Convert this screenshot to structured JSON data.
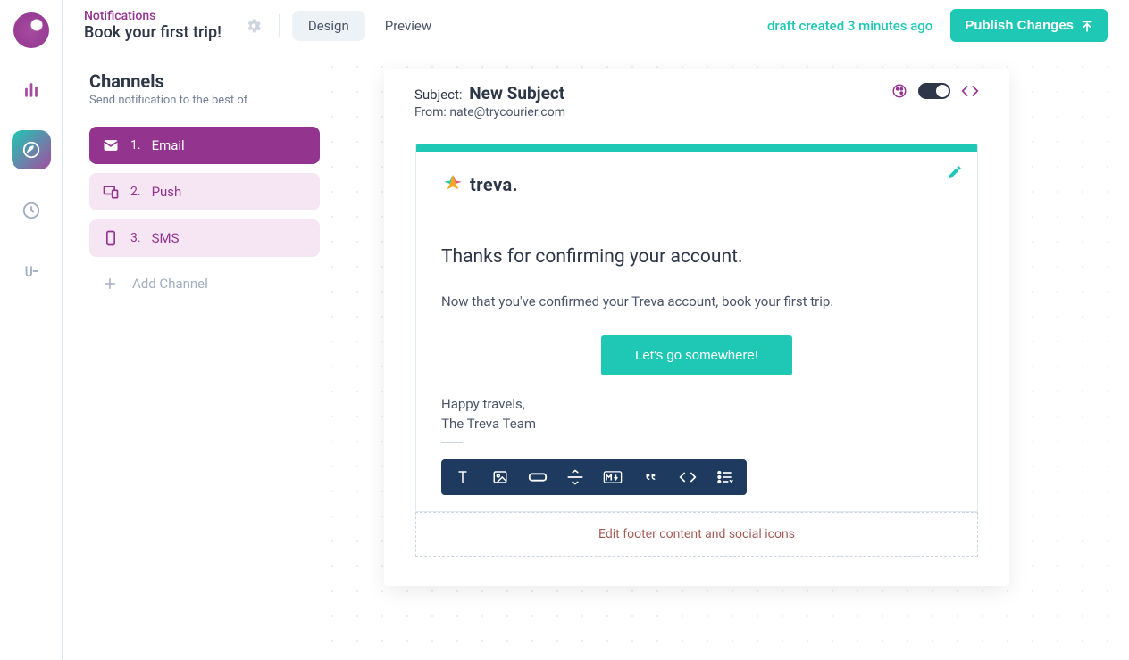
{
  "header": {
    "crumb": "Notifications",
    "title": "Book your first trip!",
    "tabs": {
      "design": "Design",
      "preview": "Preview"
    },
    "draft_status": "draft created 3 minutes ago",
    "publish_label": "Publish Changes"
  },
  "channels": {
    "heading": "Channels",
    "subheading": "Send notification to the best of",
    "items": [
      {
        "num": "1.",
        "label": "Email"
      },
      {
        "num": "2.",
        "label": "Push"
      },
      {
        "num": "3.",
        "label": "SMS"
      }
    ],
    "add_label": "Add Channel"
  },
  "email": {
    "subject_label": "Subject:",
    "subject_value": "New Subject",
    "from_label": "From:",
    "from_value": "nate@trycourier.com",
    "logo_text": "treva.",
    "heading": "Thanks for confirming your account.",
    "body": "Now that you've confirmed your Treva account, book your first trip.",
    "cta_label": "Let's go somewhere!",
    "signoff1": "Happy travels,",
    "signoff2": "The Treva Team",
    "footer_cta": "Edit footer content and social icons"
  }
}
